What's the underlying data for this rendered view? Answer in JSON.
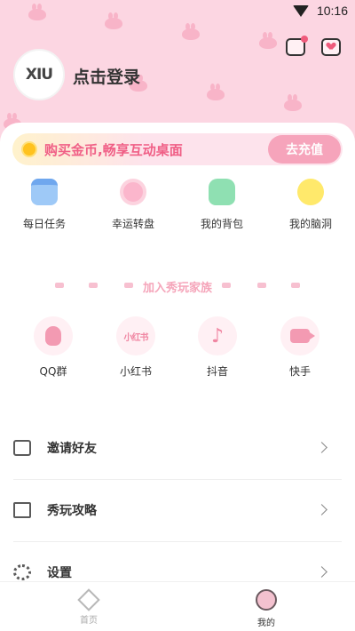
{
  "status": {
    "time": "10:16"
  },
  "colors": {
    "accent": "#f05f86",
    "hero_bg": "#fcd6e2",
    "recharge_bg": "#f6a4bb"
  },
  "header": {
    "avatar_text": "XIU",
    "login_text": "点击登录",
    "icons": [
      "message-icon",
      "heart-card-icon"
    ]
  },
  "banner": {
    "text": "购买金币,畅享互动桌面",
    "button": "去充值"
  },
  "quick_actions": [
    {
      "label": "每日任务",
      "icon": "calendar-check-icon"
    },
    {
      "label": "幸运转盘",
      "icon": "lucky-wheel-icon"
    },
    {
      "label": "我的背包",
      "icon": "backpack-icon"
    },
    {
      "label": "我的脑洞",
      "icon": "lightbulb-icon"
    }
  ],
  "family": {
    "title": "加入秀玩家族"
  },
  "social": [
    {
      "label": "QQ群",
      "icon": "qq-penguin-icon"
    },
    {
      "label": "小红书",
      "icon": "xiaohongshu-icon",
      "icon_text": "小红书"
    },
    {
      "label": "抖音",
      "icon": "douyin-icon",
      "icon_text": "♪"
    },
    {
      "label": "快手",
      "icon": "kuaishou-icon"
    }
  ],
  "menu": [
    {
      "label": "邀请好友",
      "icon": "envelope-icon"
    },
    {
      "label": "秀玩攻略",
      "icon": "book-icon"
    },
    {
      "label": "设置",
      "icon": "gear-icon"
    }
  ],
  "tabs": [
    {
      "label": "首页",
      "icon": "home-diamond-icon",
      "active": false
    },
    {
      "label": "我的",
      "icon": "profile-face-icon",
      "active": true
    }
  ]
}
